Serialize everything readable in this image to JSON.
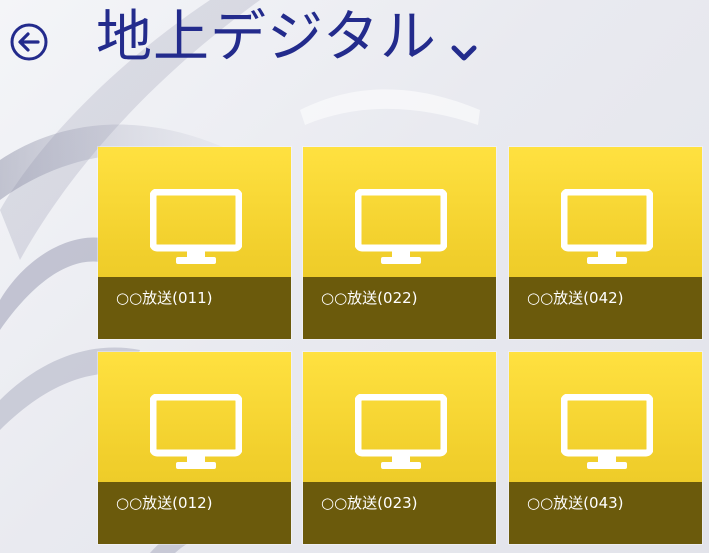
{
  "header": {
    "title": "地上デジタル"
  },
  "tiles": [
    {
      "label": "○○放送(011)",
      "icon": "tv-icon"
    },
    {
      "label": "○○放送(022)",
      "icon": "tv-icon"
    },
    {
      "label": "○○放送(042)",
      "icon": "tv-icon"
    },
    {
      "label": "○○放送(012)",
      "icon": "tv-icon"
    },
    {
      "label": "○○放送(023)",
      "icon": "tv-icon"
    },
    {
      "label": "○○放送(043)",
      "icon": "tv-icon"
    }
  ],
  "colors": {
    "title": "#232b8c",
    "tile": "#f1cf2c",
    "caption": "#6b5a0c"
  }
}
